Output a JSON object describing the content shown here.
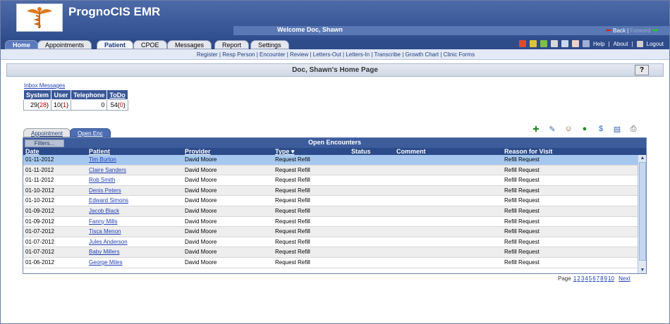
{
  "app": {
    "title": "PrognoCIS EMR",
    "welcome": "Welcome  Doc, Shawn",
    "back": "Back |",
    "forward": "Forward"
  },
  "tabs": [
    {
      "label": "Home"
    },
    {
      "label": "Appointments"
    },
    {
      "label": "Patient"
    },
    {
      "label": "CPOE"
    },
    {
      "label": "Messages"
    },
    {
      "label": "Report"
    },
    {
      "label": "Settings"
    }
  ],
  "util": {
    "help": "Help",
    "about": "About",
    "logout": "Logout"
  },
  "subnav": [
    "Register",
    "Resp Person",
    "Encounter",
    "Review",
    "Letters-Out",
    "Letters-In",
    "Transcribe",
    "Growth Chart",
    "Clinic Forms"
  ],
  "page": {
    "title": "Doc, Shawn's Home Page",
    "help": "?"
  },
  "inbox": {
    "link": "Inbox Messages",
    "headers": [
      "System",
      "User",
      "Telephone",
      "ToDo"
    ],
    "values": [
      {
        "main": "29",
        "paren": "28"
      },
      {
        "main": "10",
        "paren": "1"
      },
      {
        "main": "0",
        "paren": ""
      },
      {
        "main": "54",
        "paren": "0"
      }
    ]
  },
  "enc_tabs": {
    "appointment": "Appointment",
    "open": "Open Enc"
  },
  "grid": {
    "filters": "Filters...",
    "title": "Open Encounters",
    "headers": {
      "date": "Date",
      "patient": "Patient",
      "provider": "Provider",
      "type": "Type ▾",
      "status": "Status",
      "comment": "Comment",
      "reason": "Reason for Visit"
    },
    "rows": [
      {
        "date": "01-11-2012",
        "patient": "Tim Burton",
        "provider": "David Moore",
        "type": "Request Refill",
        "reason": "Refill Request"
      },
      {
        "date": "01-11-2012",
        "patient": "Claire Sanders",
        "provider": "David Moore",
        "type": "Request Refill",
        "reason": "Refill Request"
      },
      {
        "date": "01-11-2012",
        "patient": "Rob Smith",
        "provider": "David Moore",
        "type": "Request Refill",
        "reason": "Refill Request"
      },
      {
        "date": "01-10-2012",
        "patient": "Denis Peters",
        "provider": "David Moore",
        "type": "Request Refill",
        "reason": "Refill Request"
      },
      {
        "date": "01-10-2012",
        "patient": "Edward Simons",
        "provider": "David Moore",
        "type": "Request Refill",
        "reason": "Refill Request"
      },
      {
        "date": "01-09-2012",
        "patient": "Jacob Black",
        "provider": "David Moore",
        "type": "Request Refill",
        "reason": "Refill Request"
      },
      {
        "date": "01-09-2012",
        "patient": "Fanny Mills",
        "provider": "David Moore",
        "type": "Request Refill",
        "reason": "Refill Request"
      },
      {
        "date": "01-07-2012",
        "patient": "Tisca Menon",
        "provider": "David Moore",
        "type": "Request Refill",
        "reason": "Refill Request"
      },
      {
        "date": "01-07-2012",
        "patient": "Jules Anderson",
        "provider": "David Moore",
        "type": "Request Refill",
        "reason": "Refill Request"
      },
      {
        "date": "01-07-2012",
        "patient": "Baby Millers",
        "provider": "David Moore",
        "type": "Request Refill",
        "reason": "Refill Request"
      },
      {
        "date": "01-06-2012",
        "patient": "George Miles",
        "provider": "David Moore",
        "type": "Request Refill",
        "reason": "Refill Request"
      }
    ]
  },
  "pager": {
    "label": "Page",
    "pages": [
      "1",
      "2",
      "3",
      "4",
      "5",
      "6",
      "7",
      "8",
      "9",
      "10"
    ],
    "next": "Next"
  },
  "colors": {
    "header": "#2f4e8e",
    "selected_row": "#a6c8ef",
    "link": "#1f3fb5",
    "alert": "#d20000"
  }
}
